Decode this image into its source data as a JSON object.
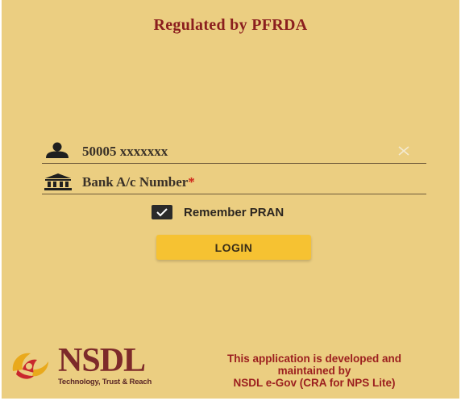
{
  "header": {
    "regulated_text": "Regulated by PFRDA"
  },
  "pran_field": {
    "value": "50005 xxxxxxx",
    "icon": "user-icon",
    "clear_icon": "close-icon"
  },
  "bank_field": {
    "placeholder": "Bank A/c Number",
    "required_mark": "*",
    "icon": "bank-icon"
  },
  "remember": {
    "label": "Remember PRAN",
    "checked": true
  },
  "login": {
    "label": "LOGIN"
  },
  "footer": {
    "brand": "NSDL",
    "tagline": "Technology, Trust & Reach",
    "dev_line1": "This application is developed and",
    "dev_line2": "maintained by",
    "dev_line3": "NSDL e-Gov (CRA for NPS Lite)"
  },
  "colors": {
    "background": "#ebce81",
    "accent_red": "#8b1e1e",
    "button": "#f6c232"
  }
}
